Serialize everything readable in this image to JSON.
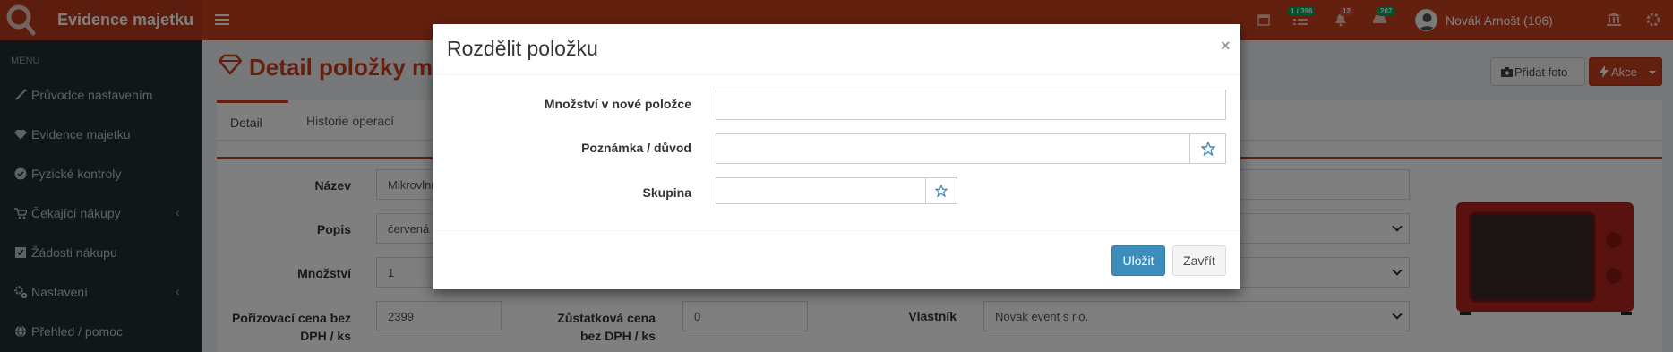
{
  "header": {
    "brand": "Evidence majetku",
    "badges": {
      "tasks": "1 / 396",
      "notifications": "12",
      "cars": "207"
    },
    "badge_colors": {
      "tasks": "#00a65a",
      "notifications": "#dd4b39",
      "cars": "#00a65a"
    },
    "user_name": "Novák Arnošt (106)",
    "icons": [
      "calendar-icon",
      "tasks-icon",
      "bell-icon",
      "car-icon",
      "bank-icon"
    ]
  },
  "sidebar": {
    "menu_header": "MENU",
    "items": [
      {
        "label": "Průvodce nastavením",
        "icon": "wand-icon"
      },
      {
        "label": "Evidence majetku",
        "icon": "diamond-icon"
      },
      {
        "label": "Fyzické kontroly",
        "icon": "check-circle-icon"
      },
      {
        "label": "Čekající nákupy",
        "icon": "cart-icon",
        "chevron": "‹"
      },
      {
        "label": "Žádosti nákupu",
        "icon": "checkbox-icon"
      },
      {
        "label": "Nastavení",
        "icon": "cogs-icon",
        "chevron": "‹"
      },
      {
        "label": "Přehled / pomoc",
        "icon": "globe-icon"
      }
    ]
  },
  "page": {
    "title": "Detail položky majetku",
    "add_photo_label": "Přidat foto",
    "actions_label": "Akce",
    "tabs": {
      "detail": "Detail",
      "history": "Historie operací"
    },
    "fields": {
      "name_label": "Název",
      "name_value": "Mikrovlnná trouba",
      "desc_label": "Popis",
      "desc_value": "červená",
      "qty_label": "Množství",
      "qty_value": "1",
      "price_label": "Pořizovací cena bez DPH / ks",
      "price_value": "2399",
      "residual_label": "Zůstatková cena bez DPH / ks",
      "residual_value": "0",
      "owner_label": "Vlastník",
      "owner_value": "Novak event s r.o."
    }
  },
  "modal": {
    "title": "Rozdělit položku",
    "close_symbol": "×",
    "fields": {
      "qty_label": "Množství v nové položce",
      "qty_value": "",
      "note_label": "Poznámka / důvod",
      "note_value": "",
      "group_label": "Skupina",
      "group_value": ""
    },
    "save_label": "Uložit",
    "close_label": "Zavřít"
  },
  "colors": {
    "brand": "#c9401f",
    "sidebar": "#222d32",
    "primary": "#3c8dbc"
  }
}
